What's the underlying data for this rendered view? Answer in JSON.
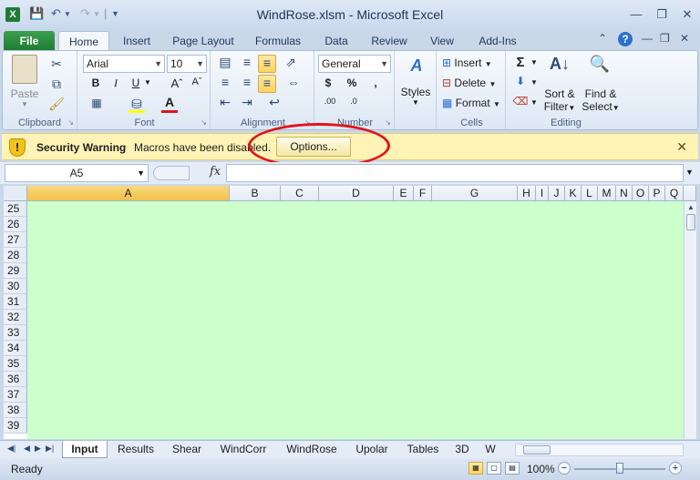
{
  "window": {
    "title": "WindRose.xlsm - Microsoft Excel",
    "app_icon_letter": "X"
  },
  "qat": {
    "save_icon": "save-icon",
    "undo_icon": "undo-icon",
    "redo_icon": "redo-icon"
  },
  "tabs": {
    "file": "File",
    "items": [
      "Home",
      "Insert",
      "Page Layout",
      "Formulas",
      "Data",
      "Review",
      "View",
      "Add-Ins"
    ],
    "active": "Home"
  },
  "ribbon": {
    "clipboard": {
      "label": "Clipboard",
      "paste": "Paste"
    },
    "font": {
      "label": "Font",
      "name": "Arial",
      "size": "10"
    },
    "alignment": {
      "label": "Alignment"
    },
    "number": {
      "label": "Number",
      "format": "General"
    },
    "styles": {
      "label": "Styles"
    },
    "cells": {
      "label": "Cells",
      "insert": "Insert",
      "delete": "Delete",
      "format": "Format"
    },
    "editing": {
      "label": "Editing",
      "sort_line1": "Sort &",
      "sort_line2": "Filter",
      "find_line1": "Find &",
      "find_line2": "Select"
    }
  },
  "security_bar": {
    "title": "Security Warning",
    "message": "Macros have been disabled.",
    "options_label": "Options...",
    "highlight_color": "#e2141b"
  },
  "formula_bar": {
    "name_box": "A5",
    "fx_label": "fx",
    "value": ""
  },
  "grid": {
    "columns": [
      "A",
      "B",
      "C",
      "D",
      "E",
      "F",
      "G",
      "H",
      "I",
      "J",
      "K",
      "L",
      "M",
      "N",
      "O",
      "P",
      "Q"
    ],
    "selected_column": "A",
    "rows": [
      "25",
      "26",
      "27",
      "28",
      "29",
      "30",
      "31",
      "32",
      "33",
      "34",
      "35",
      "36",
      "37",
      "38",
      "39"
    ],
    "cell_fill": "#ccffcc"
  },
  "sheets": {
    "tabs": [
      "Input",
      "Results",
      "Shear",
      "WindCorr",
      "WindRose",
      "Upolar",
      "Tables",
      "3D",
      "W"
    ],
    "active": "Input"
  },
  "status": {
    "text": "Ready",
    "zoom": "100%"
  }
}
